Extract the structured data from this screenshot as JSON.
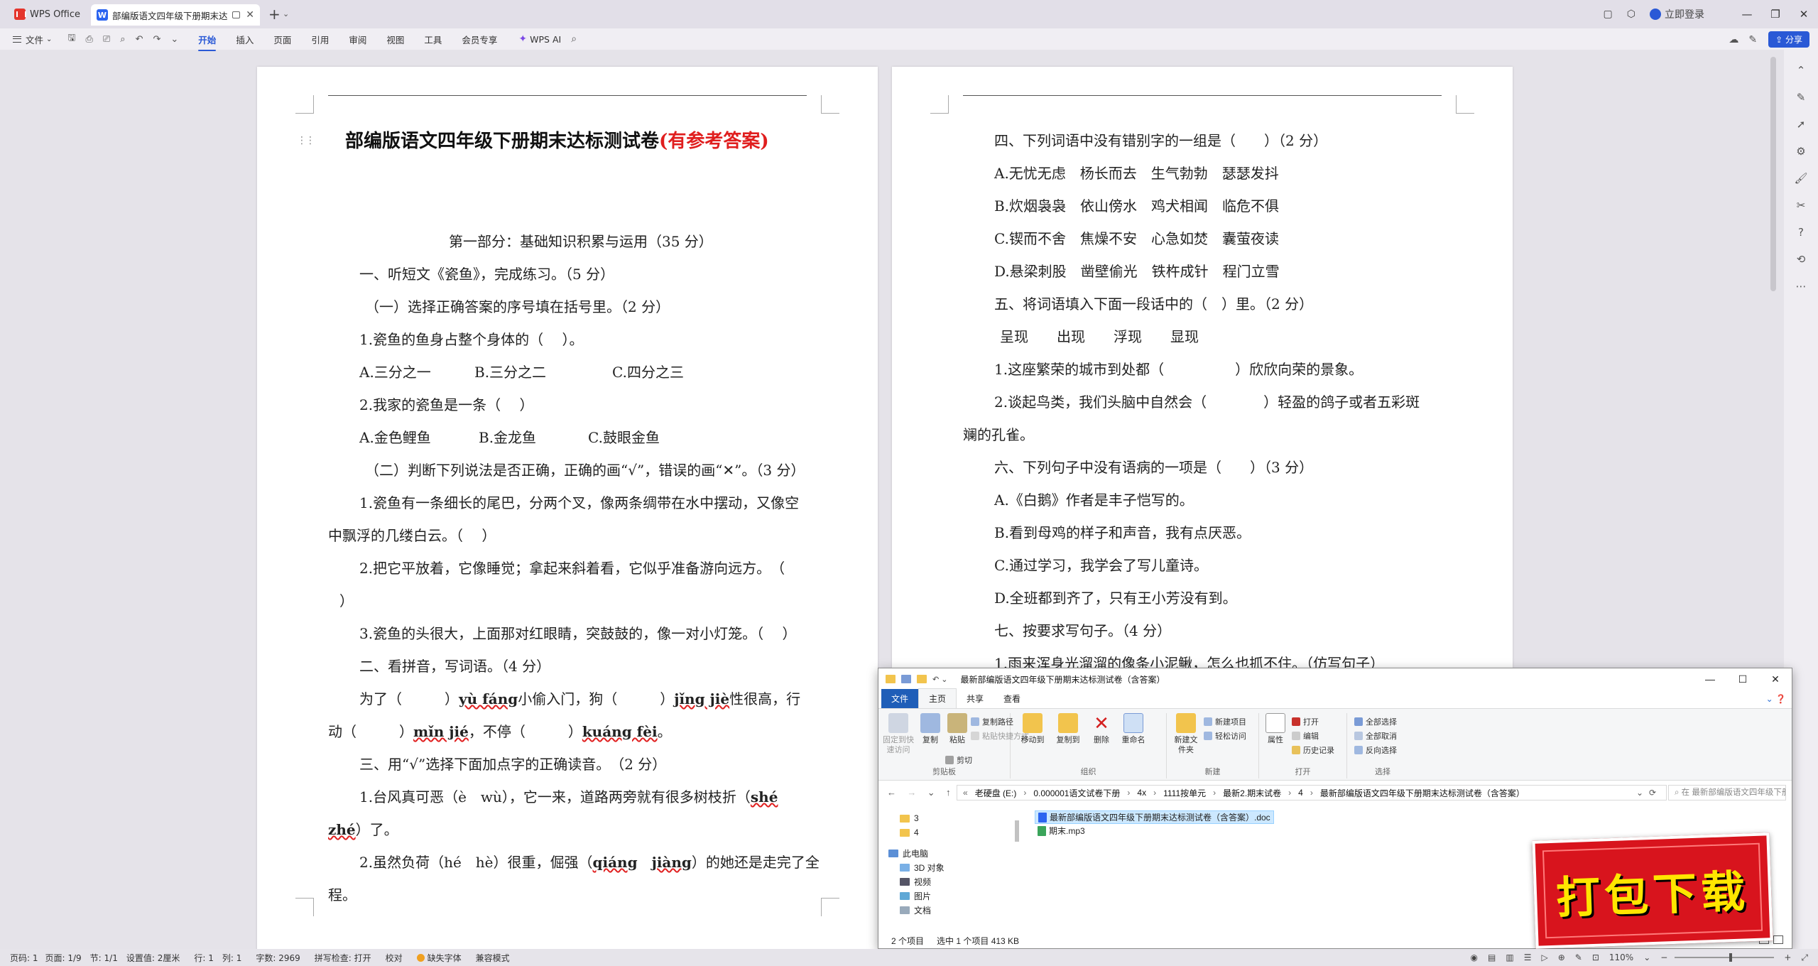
{
  "titlebar": {
    "home_tab": "WPS Office",
    "doc_tab": "部编版语文四年级下册期末达",
    "login": "立即登录"
  },
  "menu": {
    "file": "文件",
    "tabs": [
      "开始",
      "插入",
      "页面",
      "引用",
      "审阅",
      "视图",
      "工具",
      "会员专享"
    ],
    "active_tab": "开始",
    "wps_ai": "WPS AI",
    "share": "分享"
  },
  "page1": {
    "title": "部编版语文四年级下册期末达标测试卷",
    "title_answer": "(有参考答案)",
    "lines": [
      "第一部分：基础知识积累与运用（35 分）",
      "一、听短文《瓷鱼》，完成练习。（5 分）",
      "（一）选择正确答案的序号填在括号里。（2 分）",
      "1.瓷鱼的鱼身占整个身体的（　 ）。",
      "A.三分之一",
      "B.三分之二",
      "C.四分之三",
      "2.我家的瓷鱼是一条（　 ）",
      "A.金色鲤鱼",
      "B.金龙鱼",
      "C.鼓眼金鱼",
      "（二）判断下列说法是否正确，正确的画“√”，错误的画“✕”。（3 分）",
      "1.瓷鱼有一条细长的尾巴，分两个叉，像两条绸带在水中摆动，又像空",
      "中飘浮的几缕白云。（　 ）",
      "2.把它平放着，它像睡觉；拿起来斜着看，它似乎准备游向远方。　（",
      "）",
      "3.瓷鱼的头很大，上面那对红眼睛，突鼓鼓的，像一对小灯笼。（　 ）",
      "二、看拼音，写词语。（4 分）",
      "为了（　　　）",
      "yù fáng",
      "小偷入门，狗（　　　）",
      "jǐng jiè",
      "性很高，行",
      "动（　　　）",
      "mǐn jié",
      "，不停（　　　）",
      "kuáng fèi",
      "。",
      "三、用“√”选择下面加点字的正确读音。　（2 分）",
      "1.台风真可恶（è　wù），它一来，道路两旁就有很多树枝折（",
      "shé",
      "zhé",
      "）了。",
      "2.虽然负荷（hé　hè）很重，倔强（",
      "qiáng",
      "jiàng",
      "）的她还是走完了全",
      "程。"
    ]
  },
  "page2": {
    "lines": [
      "四、下列词语中没有错别字的一组是（　　）（2 分）",
      "A.无忧无虑　杨长而去　生气勃勃　瑟瑟发抖",
      "B.炊烟袅袅　依山傍水　鸡犬相闻　临危不俱",
      "C.锲而不舍　焦燥不安　心急如焚　囊萤夜读",
      "D.悬梁刺股　凿壁偷光　铁杵成针　程门立雪",
      "五、将词语填入下面一段话中的（　）里。（2 分）",
      "呈现　　出现　　浮现　　显现",
      "1.这座繁荣的城市到处都（　　　　　）欣欣向荣的景象。",
      "2.谈起鸟类，我们头脑中自然会（　　　　）轻盈的鸽子或者五彩斑",
      "斓的孔雀。",
      "六、下列句子中没有语病的一项是（　　）（3 分）",
      "A.《白鹅》作者是丰子恺写的。",
      "B.看到母鸡的样子和声音，我有点厌恶。",
      "C.通过学习，我学会了写儿童诗。",
      "D.全班都到齐了，只有王小芳没有到。",
      "七、按要求写句子。（4 分）",
      "1.雨来浑身光溜溜的像条小泥鳅，怎么也抓不住。（仿写句子）"
    ]
  },
  "explorer": {
    "title": "最新部编版语文四年级下册期末达标测试卷（含答案）",
    "tabs": [
      "文件",
      "主页",
      "共享",
      "查看"
    ],
    "ribbon": {
      "pin": "固定到快速访问",
      "copy": "复制",
      "paste": "粘贴",
      "copy_path": "复制路径",
      "paste_shortcut": "粘贴快捷方式",
      "cut": "剪切",
      "group_clipboard": "剪贴板",
      "move_to": "移动到",
      "copy_to": "复制到",
      "delete": "删除",
      "rename": "重命名",
      "group_organize": "组织",
      "new_folder": "新建文件夹",
      "new_item": "新建项目",
      "easy_access": "轻松访问",
      "group_new": "新建",
      "properties": "属性",
      "open": "打开",
      "edit": "编辑",
      "history": "历史记录",
      "group_open": "打开",
      "select_all": "全部选择",
      "select_none": "全部取消",
      "invert": "反向选择",
      "group_select": "选择"
    },
    "path": [
      "老硬盘 (E:)",
      "0.000001语文试卷下册",
      "4x",
      "1111按单元",
      "最新2.期末试卷",
      "4",
      "最新部编版语文四年级下册期末达标测试卷（含答案）"
    ],
    "search_placeholder": "在 最新部编版语文四年级下册期末...",
    "nav": [
      "3",
      "4",
      "此电脑",
      "3D 对象",
      "视频",
      "图片",
      "文档"
    ],
    "files": [
      "最新部编版语文四年级下册期末达标测试卷（含答案）.doc",
      "期末.mp3"
    ],
    "status": [
      "2 个项目",
      "选中 1 个项目  413 KB"
    ]
  },
  "badge": "打包下载",
  "statusbar": {
    "page": "页码: 1",
    "pages": "页面: 1/9",
    "section": "节: 1/1",
    "setting": "设置值: 2厘米",
    "row": "行: 1",
    "col": "列: 1",
    "words": "字数: 2969",
    "spell": "拼写检查: 打开",
    "proof": "校对",
    "missing_font": "缺失字体",
    "compat": "兼容模式",
    "zoom": "110%",
    "zoom_level": 0.55
  }
}
